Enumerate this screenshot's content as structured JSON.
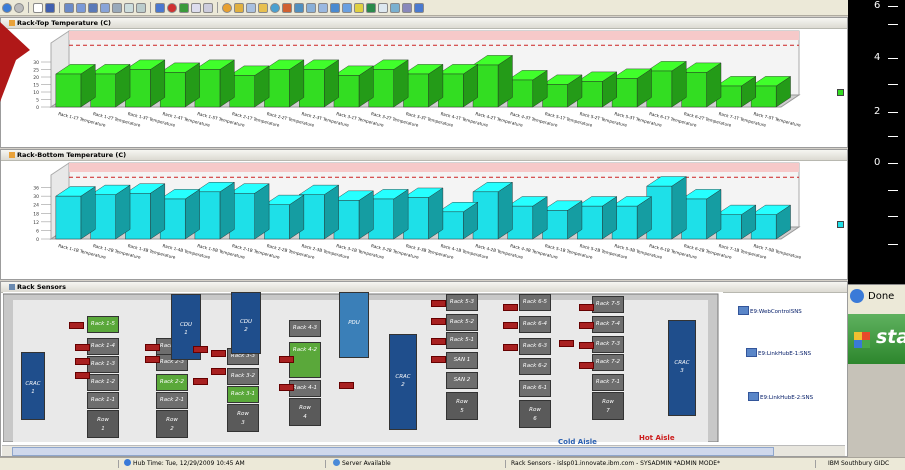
{
  "top_chart": {
    "title": "Rack-Top Temperature (C)"
  },
  "bottom_chart": {
    "title": "Rack-Bottom Temperature (C)"
  },
  "sensors_panel": {
    "title": "Rack Sensors"
  },
  "chart_data": [
    {
      "type": "bar",
      "title": "Rack-Top Temperature (C)",
      "ylim": [
        0,
        40
      ],
      "yticks": [
        "0",
        "5",
        "10",
        "15",
        "20",
        "25",
        "30"
      ],
      "color": "#33dd22",
      "categories": [
        "Rack 1-1T Temperature",
        "Rack 1-2T Temperature",
        "Rack 1-3T Temperature",
        "Rack 1-4T Temperature",
        "Rack 1-5T Temperature",
        "Rack 2-1T Temperature",
        "Rack 2-2T Temperature",
        "Rack 2-3T Temperature",
        "Rack 3-1T Temperature",
        "Rack 3-2T Temperature",
        "Rack 3-3T Temperature",
        "Rack 4-1T Temperature",
        "Rack 4-2T Temperature",
        "Rack 4-3T Temperature",
        "Rack 5-1T Temperature",
        "Rack 5-2T Temperature",
        "Rack 5-3T Temperature",
        "Rack 6-1T Temperature",
        "Rack 6-2T Temperature",
        "Rack 7-1T Temperature",
        "Rack 7-5T Temperature"
      ],
      "values": [
        22,
        22,
        25,
        23,
        25,
        21,
        25,
        25,
        21,
        25,
        22,
        22,
        28,
        18,
        15,
        17,
        19,
        24,
        23,
        14,
        14
      ]
    },
    {
      "type": "bar",
      "title": "Rack-Bottom Temperature (C)",
      "ylim": [
        0,
        42
      ],
      "yticks": [
        "0",
        "6",
        "12",
        "18",
        "24",
        "30",
        "36"
      ],
      "color": "#1ee0e8",
      "categories": [
        "Rack 1-1B Temperature",
        "Rack 1-2B Temperature",
        "Rack 1-3B Temperature",
        "Rack 1-4B Temperature",
        "Rack 1-5B Temperature",
        "Rack 2-1B Temperature",
        "Rack 2-2B Temperature",
        "Rack 2-3B Temperature",
        "Rack 3-1B Temperature",
        "Rack 3-2B Temperature",
        "Rack 3-3B Temperature",
        "Rack 4-1B Temperature",
        "Rack 4-2B Temperature",
        "Rack 4-3B Temperature",
        "Rack 5-1B Temperature",
        "Rack 5-2B Temperature",
        "Rack 5-3B Temperature",
        "Rack 6-1B Temperature",
        "Rack 6-2B Temperature",
        "Rack 7-1B Temperature",
        "Rack 7-5B Temperature"
      ],
      "values": [
        30,
        31,
        32,
        28,
        33,
        32,
        24,
        31,
        27,
        28,
        29,
        19,
        33,
        23,
        20,
        23,
        23,
        37,
        28,
        17,
        17
      ]
    }
  ],
  "right_axis": {
    "ticks": [
      "6",
      "4",
      "2",
      "0"
    ]
  },
  "browser": {
    "done_label": "Done",
    "start_label": "sta"
  },
  "floor": {
    "racks": [
      "Rack 1-5",
      "Rack 1-4",
      "Rack 1-3",
      "Rack 1-2",
      "Rack 1-1",
      "Rack 2-4",
      "Rack 2-3",
      "Rack 2-2",
      "Rack 2-1",
      "Rack 3-3",
      "Rack 3-2",
      "Rack 3-1",
      "Rack 4-3",
      "Rack 4-2",
      "Rack 4-1",
      "Rack 5-3",
      "Rack 5-2",
      "Rack 5-1",
      "SAN 1",
      "SAN 2",
      "Rack 6-5",
      "Rack 6-4",
      "Rack 6-3",
      "Rack 6-2",
      "Rack 6-1",
      "Rack 7-5",
      "Rack 7-4",
      "Rack 7-3",
      "Rack 7-2",
      "Rack 7-1"
    ],
    "rows": [
      "Row\n1",
      "Row\n2",
      "Row\n3",
      "Row\n4",
      "Row\n5",
      "Row\n6",
      "Row\n7"
    ],
    "units": [
      "CRAC\n1",
      "CDU\n1",
      "CDU\n2",
      "PDU",
      "CRAC\n2",
      "CRAC\n3"
    ],
    "aisles": {
      "cold": "Cold Aisle",
      "hot": "Hot Aisle"
    },
    "sns_labels": [
      "E9:WebControlSNS",
      "E9:LinkHubE-1:SNS",
      "E9:LinkHubE-2:SNS"
    ]
  },
  "status_bar": {
    "hub_time": "Hub Time: Tue, 12/29/2009 10:45 AM",
    "server": "Server Available",
    "session": "Rack Sensors - islsp01.innovate.ibm.com - SYSADMIN  *ADMIN MODE*",
    "location": "IBM Southbury GIDC"
  }
}
